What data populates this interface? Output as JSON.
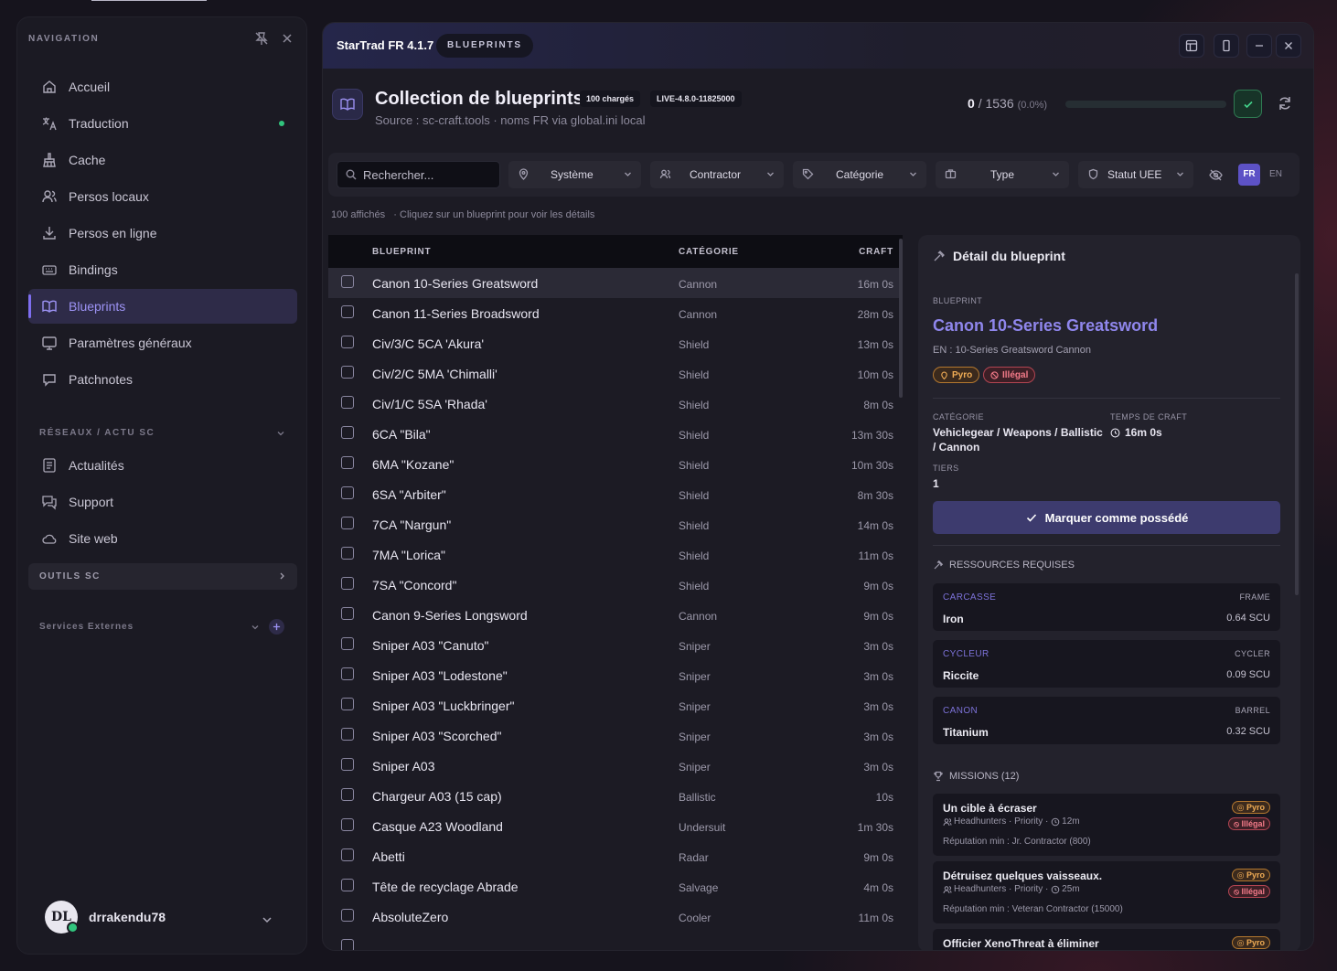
{
  "sidebar": {
    "heading": "NAVIGATION",
    "items": [
      {
        "label": "Accueil",
        "icon": "home-icon"
      },
      {
        "label": "Traduction",
        "icon": "translate-icon"
      },
      {
        "label": "Cache",
        "icon": "broom-icon"
      },
      {
        "label": "Persos locaux",
        "icon": "users-icon"
      },
      {
        "label": "Persos en ligne",
        "icon": "download-icon"
      },
      {
        "label": "Bindings",
        "icon": "keyboard-icon"
      },
      {
        "label": "Blueprints",
        "icon": "book-icon"
      },
      {
        "label": "Paramètres généraux",
        "icon": "monitor-icon"
      },
      {
        "label": "Patchnotes",
        "icon": "bubble-icon"
      }
    ],
    "active_item": "Blueprints",
    "network_heading": "RÉSEAUX / ACTU SC",
    "network_items": [
      {
        "label": "Actualités",
        "icon": "news-icon"
      },
      {
        "label": "Support",
        "icon": "support-icon"
      },
      {
        "label": "Site web",
        "icon": "cloud-icon"
      }
    ],
    "tools_heading": "OUTILS SC",
    "external_heading": "Services Externes",
    "user": {
      "initials": "DL",
      "name": "drrakendu78"
    }
  },
  "titlebar": {
    "app": "StarTrad FR 4.1.7",
    "pill": "BLUEPRINTS"
  },
  "header": {
    "title": "Collection de blueprints",
    "badge_loaded": "100 chargés",
    "badge_version": "LIVE-4.8.0-11825000",
    "subtitle": "Source : sc-craft.tools · noms FR via global.ini local",
    "owned": "0",
    "total": "/ 1536",
    "percent": "(0.0%)",
    "progress": 0
  },
  "filters": {
    "search_placeholder": "Rechercher...",
    "system": "Système",
    "contractor": "Contractor",
    "category": "Catégorie",
    "type": "Type",
    "status": "Statut UEE",
    "lang_fr": "FR",
    "lang_en": "EN"
  },
  "info": {
    "shown": "100 affichés",
    "hint": "· Cliquez sur un blueprint pour voir les détails"
  },
  "table": {
    "headers": {
      "blueprint": "BLUEPRINT",
      "category": "CATÉGORIE",
      "craft": "CRAFT"
    },
    "rows": [
      {
        "name": "Canon 10-Series Greatsword",
        "cat": "Cannon",
        "craft": "16m 0s"
      },
      {
        "name": "Canon 11-Series Broadsword",
        "cat": "Cannon",
        "craft": "28m 0s"
      },
      {
        "name": "Civ/3/C 5CA 'Akura'",
        "cat": "Shield",
        "craft": "13m 0s"
      },
      {
        "name": "Civ/2/C 5MA 'Chimalli'",
        "cat": "Shield",
        "craft": "10m 0s"
      },
      {
        "name": "Civ/1/C 5SA 'Rhada'",
        "cat": "Shield",
        "craft": "8m 0s"
      },
      {
        "name": "6CA \"Bila\"",
        "cat": "Shield",
        "craft": "13m 30s"
      },
      {
        "name": "6MA \"Kozane\"",
        "cat": "Shield",
        "craft": "10m 30s"
      },
      {
        "name": "6SA \"Arbiter\"",
        "cat": "Shield",
        "craft": "8m 30s"
      },
      {
        "name": "7CA \"Nargun\"",
        "cat": "Shield",
        "craft": "14m 0s"
      },
      {
        "name": "7MA \"Lorica\"",
        "cat": "Shield",
        "craft": "11m 0s"
      },
      {
        "name": "7SA \"Concord\"",
        "cat": "Shield",
        "craft": "9m 0s"
      },
      {
        "name": "Canon 9-Series Longsword",
        "cat": "Cannon",
        "craft": "9m 0s"
      },
      {
        "name": "Sniper A03 \"Canuto\"",
        "cat": "Sniper",
        "craft": "3m 0s"
      },
      {
        "name": "Sniper A03 \"Lodestone\"",
        "cat": "Sniper",
        "craft": "3m 0s"
      },
      {
        "name": "Sniper A03 \"Luckbringer\"",
        "cat": "Sniper",
        "craft": "3m 0s"
      },
      {
        "name": "Sniper A03 \"Scorched\"",
        "cat": "Sniper",
        "craft": "3m 0s"
      },
      {
        "name": "Sniper A03",
        "cat": "Sniper",
        "craft": "3m 0s"
      },
      {
        "name": "Chargeur A03 (15 cap)",
        "cat": "Ballistic",
        "craft": "10s"
      },
      {
        "name": "Casque A23 Woodland",
        "cat": "Undersuit",
        "craft": "1m 30s"
      },
      {
        "name": "Abetti",
        "cat": "Radar",
        "craft": "9m 0s"
      },
      {
        "name": "Tête de recyclage Abrade",
        "cat": "Salvage",
        "craft": "4m 0s"
      },
      {
        "name": "AbsoluteZero",
        "cat": "Cooler",
        "craft": "11m 0s"
      }
    ]
  },
  "detail": {
    "heading": "Détail du blueprint",
    "bp_label": "BLUEPRINT",
    "bp_title": "Canon 10-Series Greatsword",
    "bp_en": "EN : 10-Series Greatsword Cannon",
    "tag_pyro": "Pyro",
    "tag_illegal": "Illégal",
    "cat_label": "CATÉGORIE",
    "cat_line1": "Vehiclegear / Weapons / Ballistic",
    "cat_line2": "/ Cannon",
    "time_label": "TEMPS DE CRAFT",
    "time_value": "16m 0s",
    "tiers_label": "TIERS",
    "tiers_value": "1",
    "mark_button": "Marquer comme possédé",
    "resources_heading": "RESSOURCES REQUISES",
    "resources": [
      {
        "slot": "CARCASSE",
        "role": "FRAME",
        "material": "Iron",
        "qty": "0.64 SCU"
      },
      {
        "slot": "CYCLEUR",
        "role": "CYCLER",
        "material": "Riccite",
        "qty": "0.09 SCU"
      },
      {
        "slot": "CANON",
        "role": "BARREL",
        "material": "Titanium",
        "qty": "0.32 SCU"
      }
    ],
    "missions_heading": "MISSIONS (12)",
    "missions": [
      {
        "title": "Un cible à écraser",
        "org": "Headhunters",
        "prio": "· Priority ·",
        "time": "12m",
        "rep": "Réputation min : Jr. Contractor (800)",
        "pyro": "Pyro",
        "ill": "Illégal"
      },
      {
        "title": "Détruisez quelques vaisseaux.",
        "org": "Headhunters",
        "prio": "· Priority ·",
        "time": "25m",
        "rep": "Réputation min : Veteran Contractor (15000)",
        "pyro": "Pyro",
        "ill": "Illégal"
      },
      {
        "title": "Officier XenoThreat à éliminer",
        "org": "",
        "prio": "",
        "time": "",
        "rep": "",
        "pyro": "Pyro",
        "ill": ""
      }
    ]
  },
  "colors": {
    "accent": "#7e6ef0",
    "success": "#31c47d",
    "pyro": "#f0ac55",
    "illegal": "#f27a88"
  }
}
